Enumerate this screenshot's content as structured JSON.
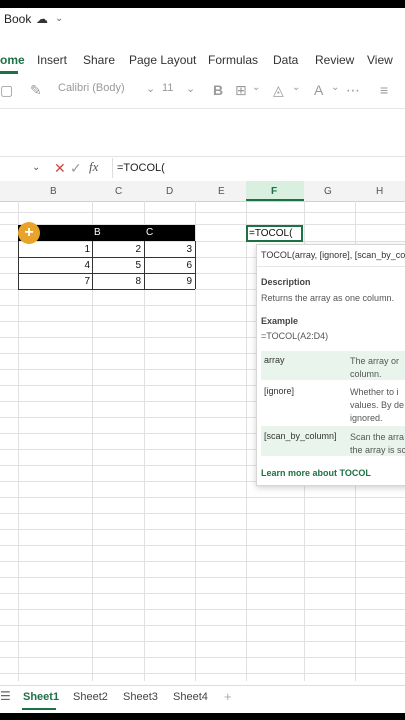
{
  "title": {
    "doc": "Book"
  },
  "ribbon": {
    "tabs": [
      "ome",
      "Insert",
      "Share",
      "Page Layout",
      "Formulas",
      "Data",
      "Review",
      "View"
    ]
  },
  "toolbar": {
    "font": "Calibri (Body)",
    "size": "11"
  },
  "formula_bar": {
    "content": "=TOCOL("
  },
  "grid": {
    "columns": [
      "B",
      "C",
      "D",
      "E",
      "F",
      "G",
      "H"
    ],
    "table": {
      "headers": [
        "B",
        "C"
      ],
      "rows": [
        [
          "1",
          "2",
          "3"
        ],
        [
          "4",
          "5",
          "6"
        ],
        [
          "7",
          "8",
          "9"
        ]
      ]
    },
    "active_cell_text": "=TOCOL("
  },
  "tooltip": {
    "signature": "TOCOL(array, [ignore], [scan_by_co",
    "description_heading": "Description",
    "description": "Returns the array as one column.",
    "example_heading": "Example",
    "example": "=TOCOL(A2:D4)",
    "args": [
      {
        "name": "array",
        "desc1": "The array or",
        "desc2": "column.",
        "desc3": ""
      },
      {
        "name": "[ignore]",
        "desc1": "Whether to i",
        "desc2": "values. By de",
        "desc3": "ignored."
      },
      {
        "name": "[scan_by_column]",
        "desc1": "Scan the arra",
        "desc2": "the array is sc",
        "desc3": ""
      }
    ],
    "link": "Learn more about TOCOL"
  },
  "sheets": [
    "Sheet1",
    "Sheet2",
    "Sheet3",
    "Sheet4"
  ],
  "add_sheet": "+",
  "colors": {
    "accent": "#1e7145"
  }
}
